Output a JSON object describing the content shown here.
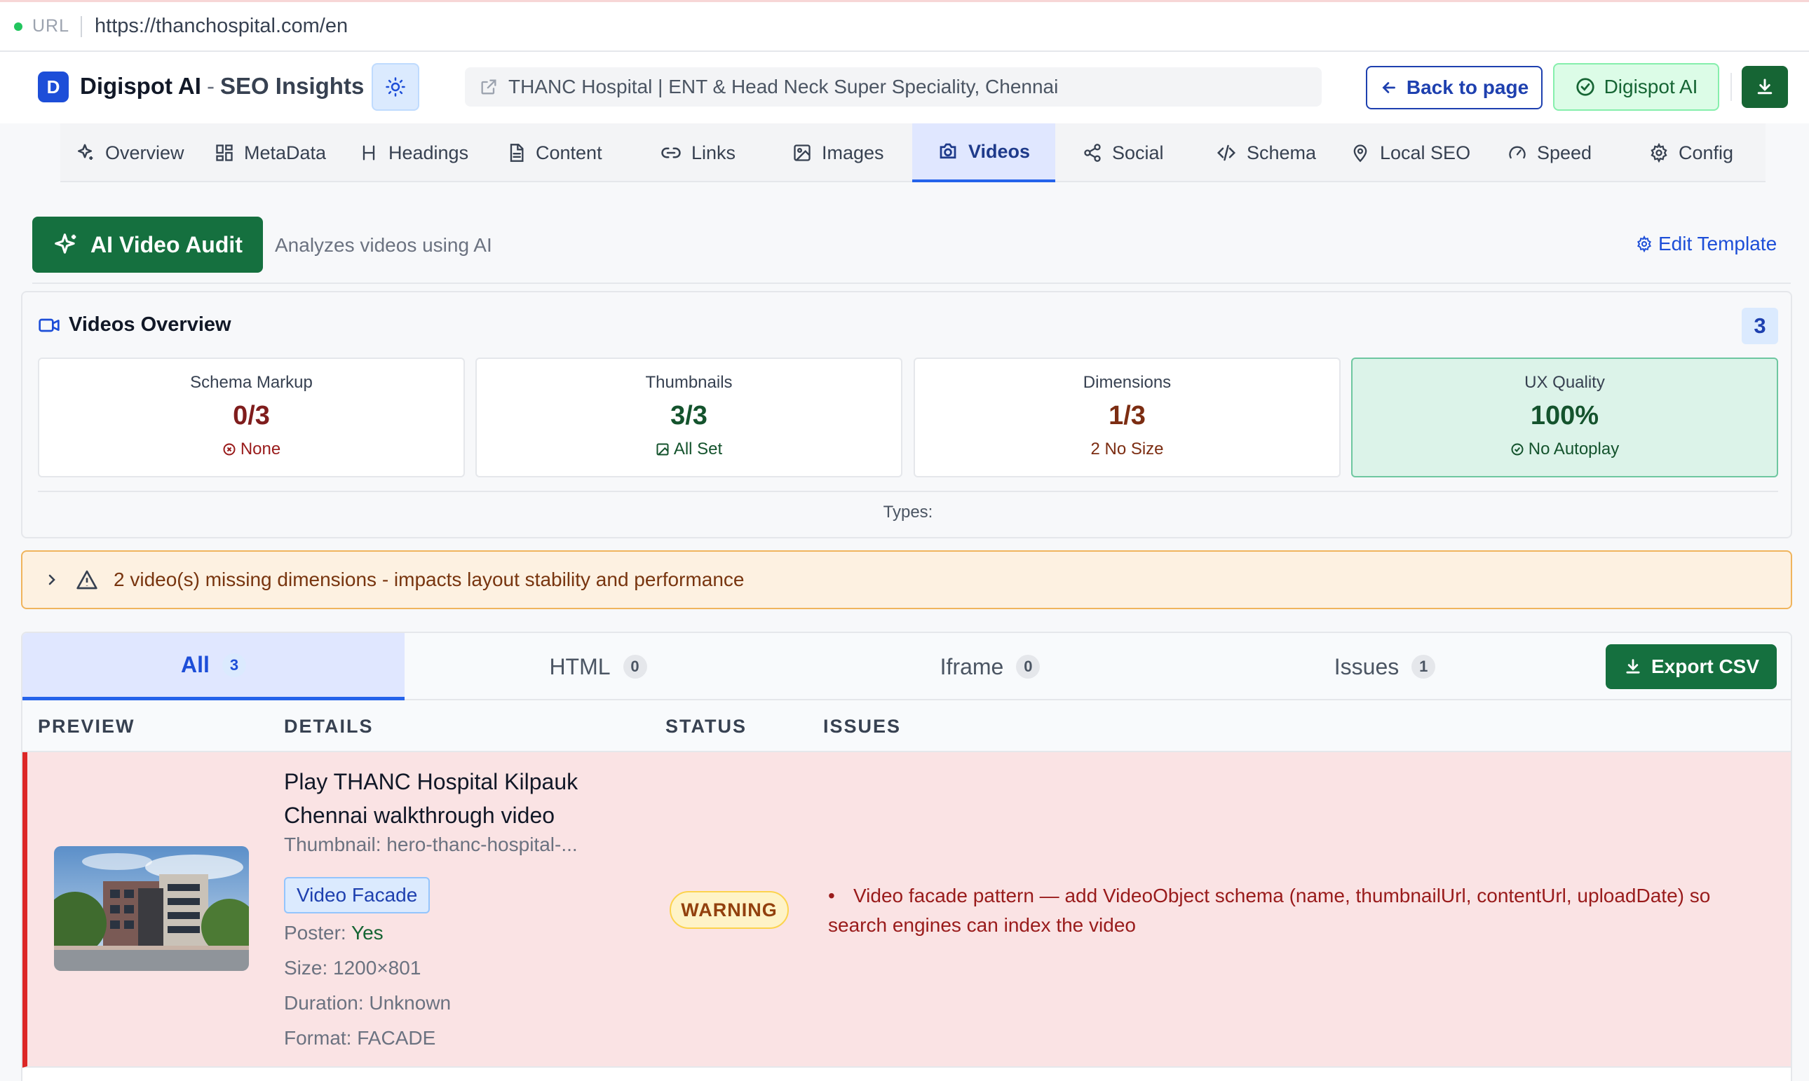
{
  "urlbar": {
    "label": "URL",
    "url": "https://thanchospital.com/en"
  },
  "header": {
    "logo_letter": "D",
    "brand": "Digispot AI",
    "separator": "-",
    "subtitle": "SEO Insights",
    "page_title": "THANC Hospital | ENT & Head Neck Super Speciality, Chennai",
    "back_label": "Back to page",
    "ai_label": "Digispot AI"
  },
  "nav": {
    "tabs": [
      {
        "label": "Overview",
        "icon": "sparkle-icon"
      },
      {
        "label": "MetaData",
        "icon": "grid-icon"
      },
      {
        "label": "Headings",
        "icon": "heading-icon"
      },
      {
        "label": "Content",
        "icon": "document-icon"
      },
      {
        "label": "Links",
        "icon": "link-icon"
      },
      {
        "label": "Images",
        "icon": "image-icon"
      },
      {
        "label": "Videos",
        "icon": "camera-icon",
        "active": true
      },
      {
        "label": "Social",
        "icon": "share-icon"
      },
      {
        "label": "Schema",
        "icon": "code-icon"
      },
      {
        "label": "Local SEO",
        "icon": "pin-icon"
      },
      {
        "label": "Speed",
        "icon": "gauge-icon"
      },
      {
        "label": "Config",
        "icon": "gear-icon"
      }
    ]
  },
  "audit": {
    "button_label": "AI Video Audit",
    "description": "Analyzes videos using AI",
    "edit_template": "Edit Template"
  },
  "overview": {
    "title": "Videos Overview",
    "count": "3",
    "stats": [
      {
        "label": "Schema Markup",
        "value": "0/3",
        "footer": "None",
        "color": "#7f1d1d",
        "footer_color": "#991b1b"
      },
      {
        "label": "Thumbnails",
        "value": "3/3",
        "footer": "All Set",
        "color": "#14532d",
        "footer_color": "#14532d"
      },
      {
        "label": "Dimensions",
        "value": "1/3",
        "footer": "2 No Size",
        "color": "#7c2d12",
        "footer_color": "#7c2d12"
      },
      {
        "label": "UX Quality",
        "value": "100%",
        "footer": "No Autoplay",
        "color": "#14532d",
        "footer_color": "#14532d"
      }
    ],
    "types_label": "Types:"
  },
  "warning": {
    "text": "2 video(s) missing dimensions - impacts layout stability and performance"
  },
  "video_tabs": [
    {
      "label": "All",
      "count": "3",
      "active": true
    },
    {
      "label": "HTML",
      "count": "0"
    },
    {
      "label": "Iframe",
      "count": "0"
    },
    {
      "label": "Issues",
      "count": "1"
    }
  ],
  "export_label": "Export CSV",
  "table": {
    "headers": [
      "PREVIEW",
      "DETAILS",
      "STATUS",
      "ISSUES"
    ],
    "rows": [
      {
        "title": "Play THANC Hospital Kilpauk Chennai walkthrough video",
        "thumbnail_label": "Thumbnail:",
        "thumbnail_value": "hero-thanc-hospital-...",
        "tag": "Video Facade",
        "poster_label": "Poster:",
        "poster_value": "Yes",
        "size": "Size: 1200×801",
        "duration": "Duration: Unknown",
        "format": "Format: FACADE",
        "status": "WARNING",
        "issue": "Video facade pattern — add VideoObject schema (name, thumbnailUrl, contentUrl, uploadDate) so search engines can index the video"
      }
    ]
  },
  "colors": {
    "brand_blue": "#1d4ed8",
    "primary_green": "#15703f",
    "error_red": "#dc2626"
  }
}
